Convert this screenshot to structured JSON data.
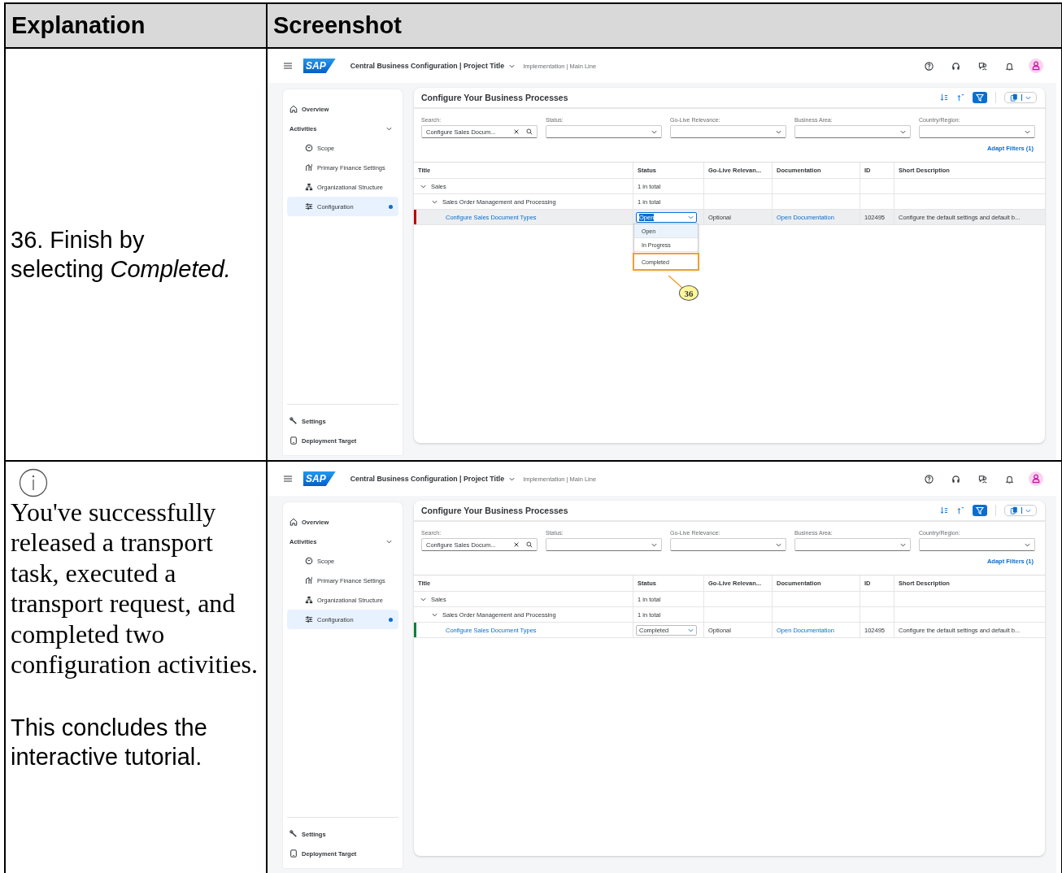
{
  "headers": [
    "Explanation",
    "Screenshot"
  ],
  "rows": [
    {
      "explanation": {
        "info_icon": false,
        "paragraphs": [
          {
            "kind": "sans",
            "text": "36. Finish by selecting *Completed.*"
          }
        ]
      },
      "screen": {
        "shell": {
          "logo": "SAP",
          "title": "Central Business Configuration | Project Title",
          "subtitle": "Implementation | Main Line"
        },
        "nav_top": "Overview",
        "nav_section": {
          "label": "Activities",
          "expanded": true
        },
        "nav_items": [
          {
            "label": "Scope",
            "selected": false
          },
          {
            "label": "Primary Finance Settings",
            "selected": false
          },
          {
            "label": "Organizational Structure",
            "selected": false
          },
          {
            "label": "Configuration",
            "selected": true
          }
        ],
        "nav_bottom": [
          "Settings",
          "Deployment Target"
        ],
        "page_title": "Configure Your Business Processes",
        "filters": [
          {
            "kind": "search",
            "label": "Search:",
            "value": "Configure Sales Docum..."
          },
          {
            "kind": "select",
            "label": "Status:"
          },
          {
            "kind": "select",
            "label": "Go-Live Relevance:"
          },
          {
            "kind": "select",
            "label": "Business Area:"
          },
          {
            "kind": "select",
            "label": "Country/Region:"
          }
        ],
        "adapt_filters": "Adapt Filters (1)",
        "columns": [
          "Title",
          "Status",
          "Go-Live Relevan...",
          "Documentation",
          "ID",
          "Short Description"
        ],
        "tree": [
          {
            "kind": "group",
            "title": "Sales",
            "status": "1 in total",
            "expanded": true,
            "children": [
              {
                "kind": "group",
                "title": "Sales Order Management and Processing",
                "status": "1 in total",
                "expanded": true,
                "children": [
                  {
                    "kind": "activity",
                    "title": "Configure Sales Document Types",
                    "status": "Open",
                    "editing": true,
                    "selected": true,
                    "color": "#bb0000",
                    "relevance": "Optional",
                    "documentation": "Open Documentation",
                    "id": "102495",
                    "description": "Configure the default settings and default b...",
                    "dropdown": {
                      "options": [
                        {
                          "label": "Open",
                          "selected": true,
                          "marked": false
                        },
                        {
                          "label": "In Progress",
                          "selected": false,
                          "marked": false
                        },
                        {
                          "label": "Completed",
                          "selected": false,
                          "marked": true
                        }
                      ],
                      "callout": "36"
                    }
                  }
                ]
              }
            ]
          }
        ]
      }
    },
    {
      "explanation": {
        "info_icon": true,
        "paragraphs": [
          {
            "kind": "serif",
            "text": "You've successfully released a transport task, executed a transport request, and completed two configuration activities."
          },
          {
            "kind": "sans",
            "text": "This concludes the interactive tutorial."
          }
        ]
      },
      "screen": {
        "shell": {
          "logo": "SAP",
          "title": "Central Business Configuration | Project Title",
          "subtitle": "Implementation | Main Line"
        },
        "nav_top": "Overview",
        "nav_section": {
          "label": "Activities",
          "expanded": true
        },
        "nav_items": [
          {
            "label": "Scope",
            "selected": false
          },
          {
            "label": "Primary Finance Settings",
            "selected": false
          },
          {
            "label": "Organizational Structure",
            "selected": false
          },
          {
            "label": "Configuration",
            "selected": true
          }
        ],
        "nav_bottom": [
          "Settings",
          "Deployment Target"
        ],
        "page_title": "Configure Your Business Processes",
        "filters": [
          {
            "kind": "search",
            "label": "Search:",
            "value": "Configure Sales Docum..."
          },
          {
            "kind": "select",
            "label": "Status:"
          },
          {
            "kind": "select",
            "label": "Go-Live Relevance:"
          },
          {
            "kind": "select",
            "label": "Business Area:"
          },
          {
            "kind": "select",
            "label": "Country/Region:"
          }
        ],
        "adapt_filters": "Adapt Filters (1)",
        "columns": [
          "Title",
          "Status",
          "Go-Live Relevan...",
          "Documentation",
          "ID",
          "Short Description"
        ],
        "tree": [
          {
            "kind": "group",
            "title": "Sales",
            "status": "1 in total",
            "expanded": true,
            "children": [
              {
                "kind": "group",
                "title": "Sales Order Management and Processing",
                "status": "1 in total",
                "expanded": true,
                "children": [
                  {
                    "kind": "activity",
                    "title": "Configure Sales Document Types",
                    "status": "Completed",
                    "editing": false,
                    "selected": false,
                    "color": "#107e3e",
                    "relevance": "Optional",
                    "documentation": "Open Documentation",
                    "id": "102495",
                    "description": "Configure the default settings and default b..."
                  }
                ]
              }
            ]
          }
        ]
      }
    }
  ]
}
